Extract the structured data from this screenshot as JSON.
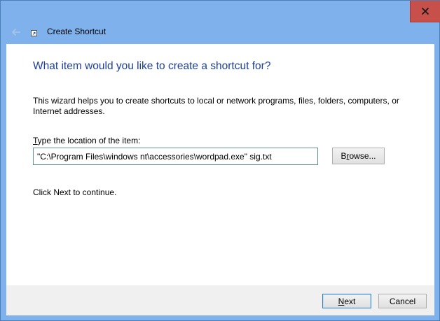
{
  "window": {
    "title": "Create Shortcut",
    "close_icon": "close-icon",
    "back_icon": "back-arrow-icon",
    "app_icon": "shortcut-icon"
  },
  "wizard": {
    "heading": "What item would you like to create a shortcut for?",
    "description": "This wizard helps you to create shortcuts to local or network programs, files, folders, computers, or Internet addresses.",
    "location_label_mnemonic": "T",
    "location_label_rest": "ype the location of the item:",
    "location_value": "\"C:\\Program Files\\windows nt\\accessories\\wordpad.exe\" sig.txt",
    "browse_label_prefix": "B",
    "browse_label_mnemonic": "r",
    "browse_label_rest": "owse...",
    "hint": "Click Next to continue."
  },
  "footer": {
    "next_mnemonic": "N",
    "next_rest": "ext",
    "cancel_label": "Cancel"
  },
  "colors": {
    "frame": "#7fb2ec",
    "close_button": "#c7504b",
    "heading": "#1c3f9a",
    "footer": "#f0f0f0"
  }
}
